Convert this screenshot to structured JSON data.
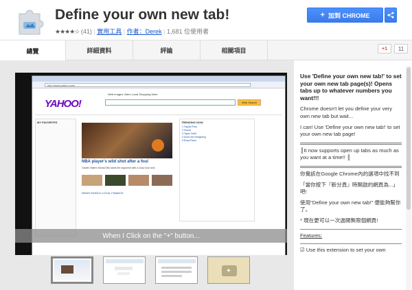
{
  "header": {
    "title": "Define your own new tab!",
    "rating_count": "(41)",
    "category": "實用工具",
    "author": "作者：Derek",
    "users": "1,681 位使用者",
    "add_button": "加到 CHROME"
  },
  "tabs": [
    {
      "label": "總覽"
    },
    {
      "label": "詳細資料"
    },
    {
      "label": "評論"
    },
    {
      "label": "相關項目"
    }
  ],
  "social": {
    "gplus_label": "+1",
    "gplus_count": "11"
  },
  "gallery": {
    "caption": "When I Click on the \"+\" button...",
    "browser_url": "http://www.yahoo.com/",
    "yahoo": {
      "logo": "YAHOO!",
      "nav": "Web   Images   Video   Local   Shopping   More",
      "search_btn": "Web Search",
      "left_title": "MY FAVORITES",
      "headline": "NBA player's wild shot after a foul",
      "headline_sub": "Golden State's Monta Ellis starts fire argument with a crazy look shot",
      "tabs": "NEWS   WORLD   LOCAL   FINANCE",
      "right_title": "TRENDING NOW",
      "right_rows": [
        "1 Toyota Prius",
        "2 Honey",
        "3 Taylor Swift",
        "4 Sonic the Hedgehog",
        "5 Rosa Parks"
      ]
    }
  },
  "description": {
    "lead": "Use 'Define your own new tab!' to set your own new tab page(s)! Opens tabs up to whatever numbers you want!!!",
    "p1": "Chrome doesn't let you define your very own new tab but wait...",
    "p2": "I can! Use 'Define your own new tab!' to set your own new tab page!",
    "p3": "║It now supports open up tabs as much as you want at a time!! ║",
    "p4": "你覺該在Google Chrome內的選項中找不到",
    "p5": "「當你按下『新分頁』時開啟的網頁為...」吧!",
    "p6": "使用\"Define your own new tab!\" 便能夠幫你了。",
    "p7": "* 現在更可以一次過開無限個網頁!",
    "features_label": "Features:",
    "feature1": "☑ Use this extension to set your own"
  }
}
